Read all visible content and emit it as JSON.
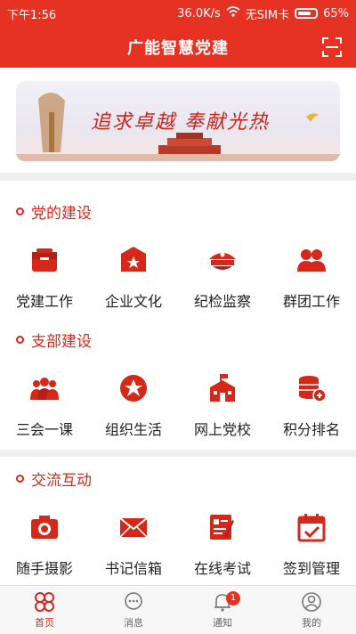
{
  "status": {
    "time": "下午1:56",
    "speed": "36.0K/s",
    "sim": "无SIM卡",
    "battery": "65%"
  },
  "header": {
    "title": "广能智慧党建"
  },
  "banner": {
    "text": "追求卓越  奉献光热"
  },
  "sections": [
    {
      "title": "党的建设",
      "items": [
        {
          "label": "党建工作",
          "icon": "briefcase-icon"
        },
        {
          "label": "企业文化",
          "icon": "shield-star-icon"
        },
        {
          "label": "纪检监察",
          "icon": "police-cap-icon"
        },
        {
          "label": "群团工作",
          "icon": "group-icon"
        }
      ]
    },
    {
      "title": "支部建设",
      "items": [
        {
          "label": "三会一课",
          "icon": "meeting-icon"
        },
        {
          "label": "组织生活",
          "icon": "star-circle-icon"
        },
        {
          "label": "网上党校",
          "icon": "school-icon"
        },
        {
          "label": "积分排名",
          "icon": "coins-icon"
        }
      ]
    },
    {
      "title": "交流互动",
      "items": [
        {
          "label": "随手摄影",
          "icon": "camera-icon"
        },
        {
          "label": "书记信箱",
          "icon": "mail-icon"
        },
        {
          "label": "在线考试",
          "icon": "exam-icon"
        },
        {
          "label": "签到管理",
          "icon": "calendar-check-icon"
        }
      ]
    }
  ],
  "tabs": [
    {
      "label": "首页",
      "icon": "home-grid-icon",
      "active": true
    },
    {
      "label": "消息",
      "icon": "chat-icon"
    },
    {
      "label": "通知",
      "icon": "bell-icon",
      "badge": "1"
    },
    {
      "label": "我的",
      "icon": "user-icon"
    }
  ],
  "colors": {
    "primary": "#e53222",
    "accent": "#d4281b"
  }
}
